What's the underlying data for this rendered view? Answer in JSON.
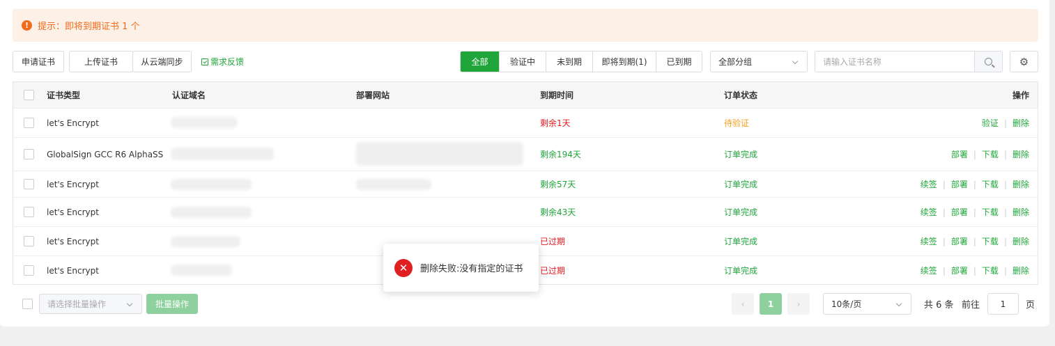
{
  "alert": {
    "icon": "warning-icon",
    "text": "提示：即将到期证书 1 个"
  },
  "toolbar": {
    "apply_label": "申请证书",
    "upload_label": "上传证书",
    "sync_label": "从云端同步",
    "feedback_label": "需求反馈",
    "filters": [
      "全部",
      "验证中",
      "未到期",
      "即将到期(1)",
      "已到期"
    ],
    "active_filter": "全部",
    "group_select": "全部分组",
    "search_placeholder": "请输入证书名称"
  },
  "table": {
    "headers": [
      "证书类型",
      "认证域名",
      "部署网站",
      "到期时间",
      "订单状态",
      "操作"
    ],
    "rows": [
      {
        "type": "let's Encrypt",
        "expiry": "剩余1天",
        "expiry_color": "red",
        "status": "待验证",
        "status_color": "orange",
        "actions": [
          "验证",
          "删除"
        ]
      },
      {
        "type": "GlobalSign GCC R6 AlphaSSL",
        "expiry": "剩余194天",
        "expiry_color": "green",
        "status": "订单完成",
        "status_color": "green",
        "actions": [
          "部署",
          "下载",
          "删除"
        ]
      },
      {
        "type": "let's Encrypt",
        "expiry": "剩余57天",
        "expiry_color": "green",
        "status": "订单完成",
        "status_color": "green",
        "actions": [
          "续签",
          "部署",
          "下载",
          "删除"
        ]
      },
      {
        "type": "let's Encrypt",
        "expiry": "剩余43天",
        "expiry_color": "green",
        "status": "订单完成",
        "status_color": "green",
        "actions": [
          "续签",
          "部署",
          "下载",
          "删除"
        ]
      },
      {
        "type": "let's Encrypt",
        "expiry": "已过期",
        "expiry_color": "red",
        "status": "订单完成",
        "status_color": "green",
        "actions": [
          "续签",
          "部署",
          "下载",
          "删除"
        ]
      },
      {
        "type": "let's Encrypt",
        "expiry": "已过期",
        "expiry_color": "red",
        "status": "订单完成",
        "status_color": "green",
        "actions": [
          "续签",
          "部署",
          "下载",
          "删除"
        ]
      }
    ]
  },
  "toast": {
    "icon": "error-icon",
    "message": "删除失败:没有指定的证书"
  },
  "footer": {
    "batch_placeholder": "请选择批量操作",
    "batch_button": "批量操作",
    "current_page": "1",
    "page_size": "10条/页",
    "total_text": "共 6 条",
    "goto_label": "前往",
    "goto_value": "1",
    "page_unit": "页"
  },
  "colors": {
    "accent": "#20a53a",
    "danger": "#e0191f",
    "warning": "#f0a020",
    "alert_bg": "#fdf0e6",
    "alert_text": "#f26b1d"
  }
}
